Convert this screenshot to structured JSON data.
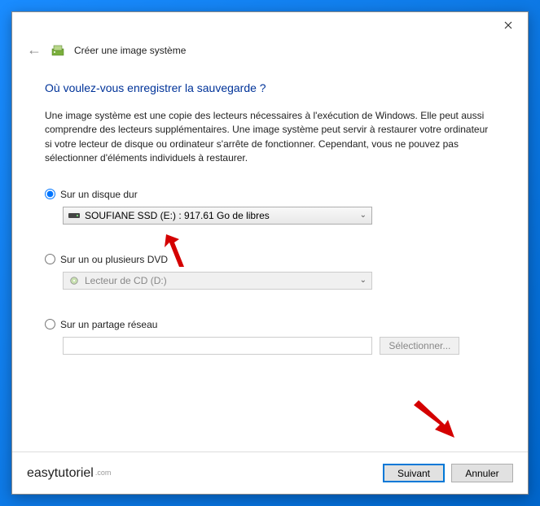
{
  "window": {
    "title": "Créer une image système"
  },
  "heading": "Où voulez-vous enregistrer la sauvegarde ?",
  "description": "Une image système est une copie des lecteurs nécessaires à l'exécution de Windows. Elle peut aussi comprendre des lecteurs supplémentaires. Une image système peut servir à restaurer votre ordinateur si votre lecteur de disque ou ordinateur s'arrête de fonctionner. Cependant, vous ne pouvez pas sélectionner d'éléments individuels à restaurer.",
  "options": {
    "hdd": {
      "label": "Sur un disque dur",
      "selected": "SOUFIANE SSD (E:) : 917.61 Go de libres"
    },
    "dvd": {
      "label": "Sur un ou plusieurs DVD",
      "selected": "Lecteur de CD (D:)"
    },
    "network": {
      "label": "Sur un partage réseau",
      "browse": "Sélectionner..."
    }
  },
  "buttons": {
    "next": "Suivant",
    "cancel": "Annuler"
  },
  "watermark": "easytutoriel"
}
